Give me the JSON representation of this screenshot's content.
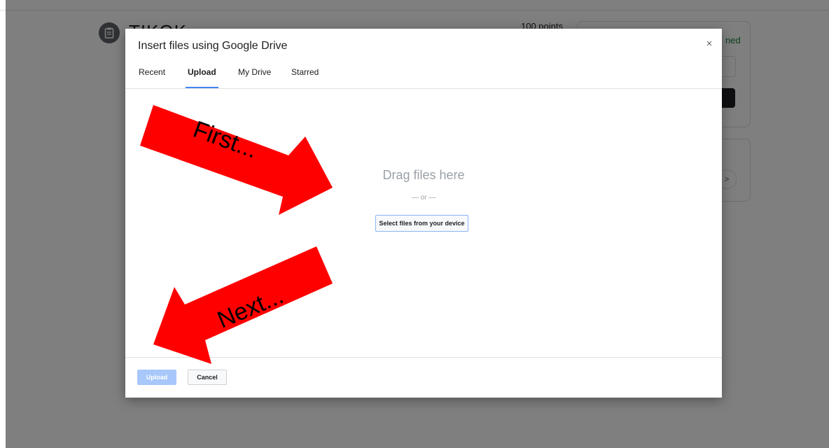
{
  "background": {
    "assignment_title": "TIKOK",
    "points": "100 points",
    "status": "ned",
    "chevron": ">"
  },
  "dialog": {
    "title": "Insert files using Google Drive",
    "close": "×",
    "tabs": [
      {
        "label": "Recent",
        "active": false
      },
      {
        "label": "Upload",
        "active": true
      },
      {
        "label": "My Drive",
        "active": false
      },
      {
        "label": "Starred",
        "active": false
      }
    ],
    "drop_text": "Drag files here",
    "or_text": "— or —",
    "select_button": "Select files from your device",
    "upload_button": "Upload",
    "cancel_button": "Cancel"
  },
  "annotations": {
    "first": "First...",
    "next": "Next...",
    "arrow_color": "#ff0000"
  }
}
